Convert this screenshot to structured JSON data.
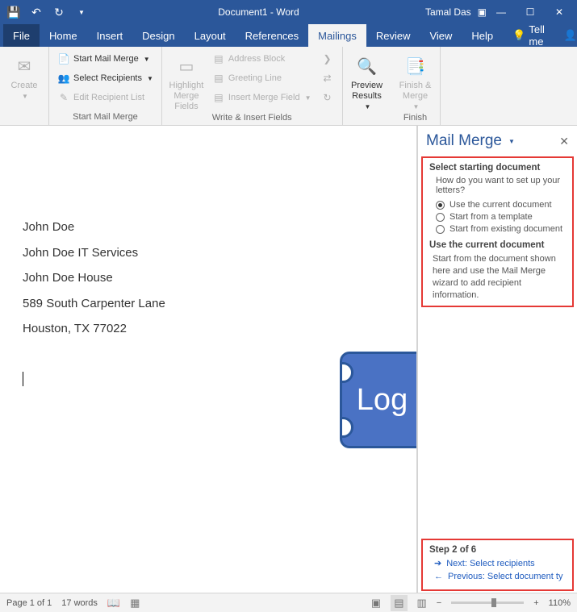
{
  "titlebar": {
    "document_title": "Document1 - Word",
    "user": "Tamal Das"
  },
  "tabs": {
    "file": "File",
    "home": "Home",
    "insert": "Insert",
    "design": "Design",
    "layout": "Layout",
    "references": "References",
    "mailings": "Mailings",
    "review": "Review",
    "view": "View",
    "help": "Help",
    "tellme": "Tell me",
    "share": "Share"
  },
  "ribbon": {
    "create": {
      "label": "Create"
    },
    "start_mail_merge_group": {
      "label": "Start Mail Merge",
      "start_mail_merge": "Start Mail Merge",
      "select_recipients": "Select Recipients",
      "edit_recipient_list": "Edit Recipient List"
    },
    "write_insert_group": {
      "label": "Write & Insert Fields",
      "highlight": "Highlight Merge Fields",
      "address_block": "Address Block",
      "greeting_line": "Greeting Line",
      "insert_merge_field": "Insert Merge Field"
    },
    "preview_results": {
      "label": "Preview Results"
    },
    "finish_group": {
      "label": "Finish",
      "finish_merge": "Finish & Merge"
    }
  },
  "document": {
    "lines": {
      "l1": "John Doe",
      "l2": "John Doe IT Services",
      "l3": "John Doe House",
      "l4": "589 South Carpenter Lane",
      "l5": "Houston, TX 77022"
    },
    "logo_text": "Log"
  },
  "taskpane": {
    "title": "Mail Merge",
    "section_heading": "Select starting document",
    "question": "How do you want to set up your letters?",
    "options": {
      "opt1": "Use the current document",
      "opt2": "Start from a template",
      "opt3": "Start from existing document"
    },
    "sub_heading": "Use the current document",
    "sub_desc": "Start from the document shown here and use the Mail Merge wizard to add recipient information.",
    "step_label": "Step 2 of 6",
    "next_link": "Next: Select recipients",
    "prev_link": "Previous: Select document ty"
  },
  "statusbar": {
    "page_info": "Page 1 of 1",
    "word_count": "17 words",
    "zoom": "110%"
  }
}
